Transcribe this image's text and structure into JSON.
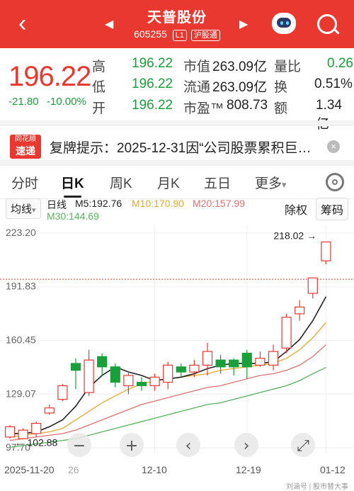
{
  "header": {
    "title": "天普股份",
    "code": "605255",
    "level": "L1",
    "market": "沪股通",
    "prev_arrow": "◀",
    "next_arrow": "▶",
    "back_glyph": "‹"
  },
  "quote": {
    "price": "196.22",
    "change": "-21.80",
    "change_pct": "-10.00%",
    "rows": [
      {
        "l1": "高",
        "v1": "196.22",
        "l2": "市值",
        "v2": "263.09亿",
        "l3": "量比",
        "v3": "0.26"
      },
      {
        "l1": "低",
        "v1": "196.22",
        "l2": "流通",
        "v2": "263.09亿",
        "l3": "换",
        "v3": "0.51%"
      },
      {
        "l1": "开",
        "v1": "196.22",
        "l2": "市盈™",
        "v2": "808.73",
        "l3": "额",
        "v3": "1.34亿"
      }
    ]
  },
  "notice": {
    "logo_top": "同花顺",
    "logo_bottom": "速递",
    "text": "复牌提示：2025-12-31因“公司股票累积巨…",
    "close": "×"
  },
  "tabs": [
    "分时",
    "日K",
    "周K",
    "月K",
    "五日",
    "更多"
  ],
  "active_tab": "日K",
  "more_caret": "▾",
  "chart_header": {
    "indicator": "均线",
    "indicator_caret": "▾",
    "period": "日线",
    "ma5": "M5:192.76",
    "ma10": "M10:170.90",
    "ma20": "M20:157.99",
    "ma30": "M30:144.69",
    "fuquan": "除权",
    "chouma": "筹码"
  },
  "colors": {
    "up": "#e8382f",
    "down": "#1aa03a",
    "ma5": "#222222",
    "ma10": "#e3a92b",
    "ma20": "#e07070",
    "ma30": "#55b35c"
  },
  "chart_data": {
    "type": "candlestick",
    "y_ticks": [
      "223.20",
      "191.83",
      "160.45",
      "129.07",
      "97.70"
    ],
    "ylim": [
      97.7,
      223.2
    ],
    "x_ticks": [
      "2025-11-20",
      "26",
      "12-10",
      "12-19",
      "01-12"
    ],
    "max_label": "218.02",
    "min_label": "102.88",
    "last_price": 196.22,
    "candles": [
      {
        "o": 104,
        "c": 110,
        "h": 111,
        "l": 103
      },
      {
        "o": 103,
        "c": 108,
        "h": 109,
        "l": 102.88
      },
      {
        "o": 106,
        "c": 112,
        "h": 113,
        "l": 104
      },
      {
        "o": 118,
        "c": 121,
        "h": 123,
        "l": 117
      },
      {
        "o": 126,
        "c": 134,
        "h": 135,
        "l": 125
      },
      {
        "o": 147,
        "c": 143,
        "h": 150,
        "l": 132
      },
      {
        "o": 130,
        "c": 149,
        "h": 155,
        "l": 128
      },
      {
        "o": 151,
        "c": 145,
        "h": 153,
        "l": 140
      },
      {
        "o": 145,
        "c": 136,
        "h": 147,
        "l": 133
      },
      {
        "o": 134,
        "c": 140,
        "h": 142,
        "l": 129
      },
      {
        "o": 136,
        "c": 134,
        "h": 139,
        "l": 131
      },
      {
        "o": 134,
        "c": 139,
        "h": 141,
        "l": 131
      },
      {
        "o": 136,
        "c": 146,
        "h": 148,
        "l": 132
      },
      {
        "o": 145,
        "c": 142,
        "h": 147,
        "l": 139
      },
      {
        "o": 142,
        "c": 146,
        "h": 149,
        "l": 139
      },
      {
        "o": 146,
        "c": 154,
        "h": 159,
        "l": 140
      },
      {
        "o": 149,
        "c": 145,
        "h": 152,
        "l": 141
      },
      {
        "o": 149,
        "c": 145,
        "h": 150,
        "l": 140
      },
      {
        "o": 153,
        "c": 145,
        "h": 155,
        "l": 138
      },
      {
        "o": 146,
        "c": 150,
        "h": 154,
        "l": 145
      },
      {
        "o": 146,
        "c": 154,
        "h": 158,
        "l": 143
      },
      {
        "o": 156,
        "c": 174,
        "h": 176,
        "l": 153
      },
      {
        "o": 176,
        "c": 180,
        "h": 184,
        "l": 172
      },
      {
        "o": 188,
        "c": 197,
        "h": 197,
        "l": 185
      },
      {
        "o": 207,
        "c": 218.02,
        "h": 218.02,
        "l": 205
      }
    ],
    "ma5": [
      106,
      106,
      107,
      110,
      114,
      122,
      133,
      140,
      145,
      142,
      140,
      137,
      138,
      139,
      141,
      144,
      146,
      147,
      147,
      147,
      148,
      154,
      161,
      172,
      186
    ],
    "ma10": [
      104,
      105,
      106,
      107,
      109,
      114,
      119,
      124,
      128,
      132,
      135,
      137,
      138,
      139,
      140,
      141,
      143,
      144,
      145,
      146,
      147,
      150,
      155,
      162,
      170.9
    ],
    "ma20": [
      102,
      103,
      104,
      105,
      106,
      108,
      111,
      114,
      117,
      120,
      123,
      125,
      127,
      129,
      131,
      133,
      134,
      136,
      138,
      140,
      141,
      143,
      146,
      151,
      157.99
    ],
    "ma30": [
      98,
      99,
      100,
      101,
      102,
      103,
      105,
      107,
      109,
      111,
      113,
      115,
      117,
      119,
      121,
      123,
      124,
      126,
      128,
      130,
      132,
      134,
      137,
      141,
      144.69
    ]
  },
  "zoom_controls": [
    "−",
    "+",
    "‹",
    "›",
    "⤢"
  ],
  "watermark": "刘涵号 | 股市替大事"
}
